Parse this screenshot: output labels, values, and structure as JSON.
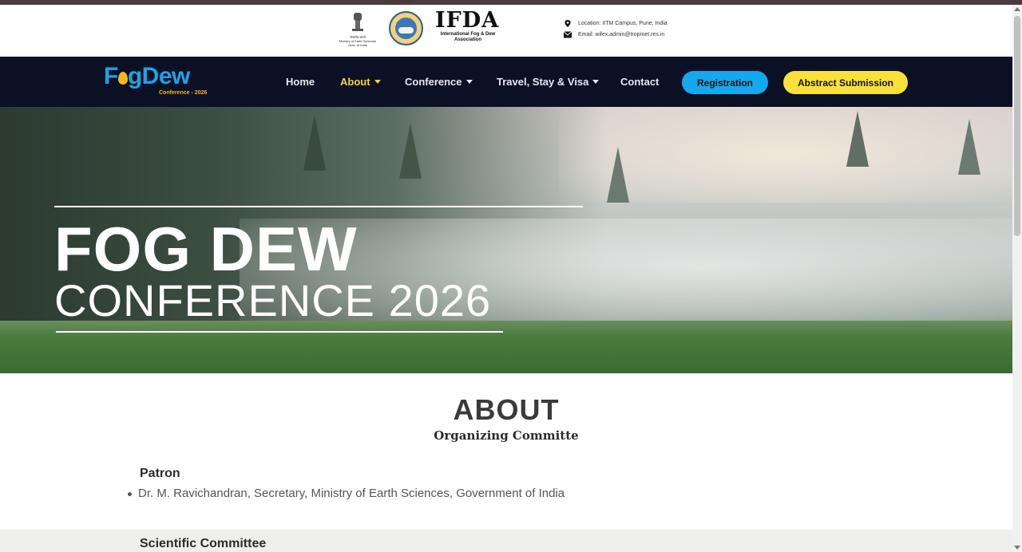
{
  "header": {
    "emblem_text": [
      "सत्यमेव जयते",
      "Ministry of Earth Sciences",
      "Govt. of India"
    ],
    "ifda_title": "IFDA",
    "ifda_subtitle": "International Fog & Dew Association",
    "location_text": "Location: IITM Campus, Pune, India",
    "email_text": "Email: wifex.admin@tropmet.res.in"
  },
  "brand": {
    "name_part1": "F",
    "name_part2": "gDew",
    "tagline": "Conference - 2026"
  },
  "nav": {
    "items": [
      {
        "label": "Home",
        "has_caret": false,
        "active": false
      },
      {
        "label": "About",
        "has_caret": true,
        "active": true
      },
      {
        "label": "Conference",
        "has_caret": true,
        "active": false
      },
      {
        "label": "Travel, Stay & Visa",
        "has_caret": true,
        "active": false
      },
      {
        "label": "Contact",
        "has_caret": false,
        "active": false
      }
    ],
    "registration_label": "Registration",
    "abstract_label": "Abstract Submission"
  },
  "hero": {
    "title": "FOG DEW",
    "subtitle": "CONFERENCE 2026"
  },
  "about": {
    "title": "ABOUT",
    "subtitle": "Organizing Committe",
    "patron_heading": "Patron",
    "patron_item": "Dr. M. Ravichandran, Secretary, Ministry of Earth Sciences, Government of India",
    "scientific_heading": "Scientific Committee"
  },
  "colors": {
    "nav_bg": "#0b1025",
    "accent_yellow": "#f6d634",
    "registration_blue": "#15a8ee",
    "brand_blue": "#1ea3e6"
  }
}
